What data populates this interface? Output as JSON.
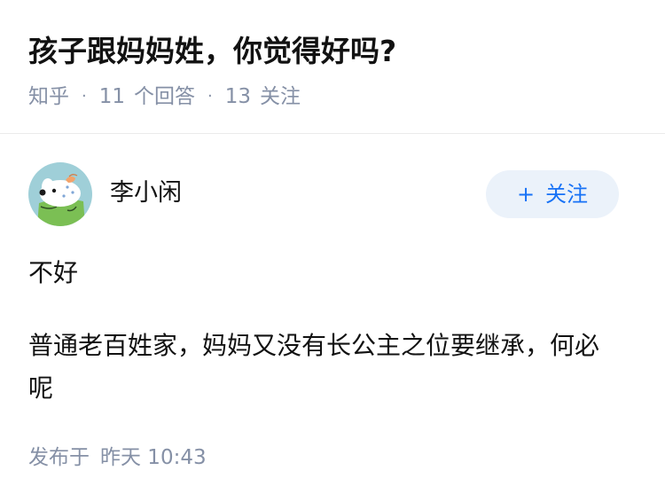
{
  "question": {
    "title": "孩子跟妈妈姓，你觉得好吗?",
    "source": "知乎",
    "answer_count": "11",
    "answer_label": "个回答",
    "follow_count": "13",
    "follow_label": "关注"
  },
  "answer": {
    "author_name": "李小闲",
    "avatar_icon": "dog-avatar-icon",
    "follow_button": {
      "plus_icon": "+",
      "label": "关注"
    },
    "paragraphs": [
      "不好",
      "普通老百姓家，妈妈又没有长公主之位要继承，何必呢"
    ],
    "time_label": "发布于",
    "time_value": "昨天 10:43"
  },
  "colors": {
    "meta_gray": "#8590a6",
    "brand_blue": "#1772f6",
    "follow_bg": "#ebf2fa",
    "avatar_bg": "#9fcfd8"
  }
}
